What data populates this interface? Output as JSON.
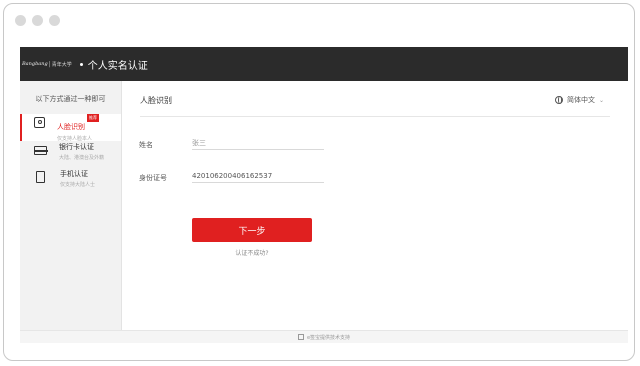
{
  "header": {
    "brand_logo": "Bangbang",
    "brand_separator": "|",
    "brand_sub": "青年大学",
    "title": "个人实名认证"
  },
  "sidebar": {
    "heading": "以下方式通过一种即可",
    "items": [
      {
        "label": "人脸识别",
        "sub": "仅支持人脸本人",
        "badge": "推荐",
        "icon": "face-id-icon",
        "active": true
      },
      {
        "label": "银行卡认证",
        "sub": "大陆、港澳台及外籍",
        "icon": "bank-card-icon",
        "active": false
      },
      {
        "label": "手机认证",
        "sub": "仅支持大陆人士",
        "icon": "phone-icon",
        "active": false
      }
    ]
  },
  "main": {
    "title": "人脸识别",
    "language": "简体中文",
    "name_label": "姓名",
    "name_placeholder": "张三",
    "id_label": "身份证号",
    "id_value": "420106200406162537",
    "next_button": "下一步",
    "fail_link": "认证不成功?"
  },
  "footer": {
    "text": "e签宝提供技术支持"
  },
  "colors": {
    "accent": "#e02020",
    "topbar": "#2b2b2b",
    "sidebar_bg": "#f2f2f2"
  }
}
